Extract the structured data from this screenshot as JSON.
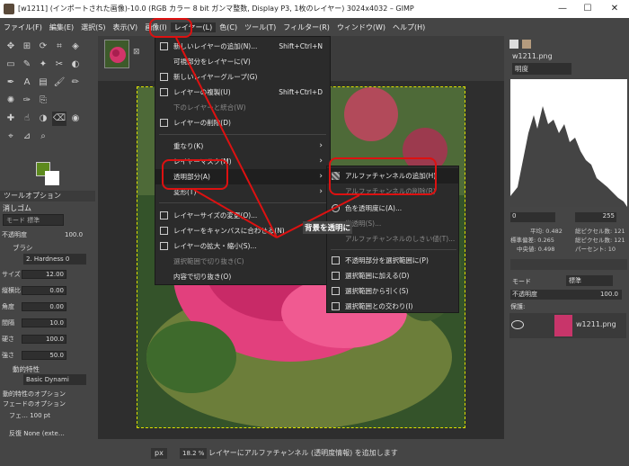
{
  "window": {
    "title": "[w1211] (インポートされた画像)-10.0 (RGB カラー 8 bit ガンマ整数, Display P3, 1枚のレイヤー) 3024x4032 – GIMP",
    "btn_min": "—",
    "btn_max": "☐",
    "btn_close": "✕"
  },
  "menubar": [
    "ファイル(F)",
    "編集(E)",
    "選択(S)",
    "表示(V)",
    "画像(I)",
    "レイヤー(L)",
    "色(C)",
    "ツール(T)",
    "フィルター(R)",
    "ウィンドウ(W)",
    "ヘルプ(H)"
  ],
  "tool_options": {
    "tab": "ツールオプション",
    "mode_label": "消しゴム",
    "mode": "モード  標準",
    "opacity_label": "不透明度",
    "opacity": "100.0",
    "brush_label": "ブラシ",
    "brush": "2. Hardness 0",
    "size_label": "サイズ",
    "size": "12.00",
    "aspect_label": "縦横比",
    "aspect": "0.00",
    "angle_label": "角度",
    "angle": "0.00",
    "spacing_label": "間隔",
    "spacing": "10.0",
    "hardness_label": "硬さ",
    "hardness": "100.0",
    "force_label": "強さ",
    "force": "50.0",
    "dynamics_label": "動的特性",
    "dynamics": "Basic Dynami",
    "dyn_opt": "動的特性のオプション",
    "fade": "フェードのオプション",
    "fade_val": "フェ… 100 pt",
    "repeat": "反復  None (exte…"
  },
  "layer_menu": {
    "items": [
      {
        "label": "新しいレイヤーの追加(N)...",
        "key": "Shift+Ctrl+N"
      },
      {
        "label": "可視部分をレイヤーに(V)",
        "key": ""
      },
      {
        "label": "新しいレイヤーグループ(G)",
        "key": ""
      },
      {
        "label": "レイヤーの複製(U)",
        "key": "Shift+Ctrl+D"
      },
      {
        "label": "下のレイヤーと統合(W)",
        "key": ""
      },
      {
        "label": "レイヤーの削除(D)",
        "key": ""
      },
      {
        "label": "重なり(K)",
        "key": ""
      },
      {
        "label": "レイヤーマスク(M)",
        "key": ""
      },
      {
        "label": "透明部分(A)",
        "key": ""
      },
      {
        "label": "変形(T)",
        "key": ""
      },
      {
        "label": "レイヤーサイズの変更(O)...",
        "key": ""
      },
      {
        "label": "レイヤーをキャンバスに合わせる(N)",
        "key": ""
      },
      {
        "label": "レイヤーの拡大・縮小(S)...",
        "key": ""
      },
      {
        "label": "選択範囲で切り抜き(C)",
        "key": ""
      },
      {
        "label": "内容で切り抜き(O)",
        "key": ""
      }
    ]
  },
  "transparency_submenu": {
    "items": [
      {
        "label": "アルファチャンネルの追加(H)"
      },
      {
        "label": "アルファチャンネルの削除(R)"
      },
      {
        "label": "色を透明度に(A)..."
      },
      {
        "label": "半透明(S)..."
      },
      {
        "label": "アルファチャンネルのしきい値(T)..."
      },
      {
        "label": "不透明部分を選択範囲に(P)"
      },
      {
        "label": "選択範囲に加える(D)"
      },
      {
        "label": "選択範囲から引く(S)"
      },
      {
        "label": "選択範囲との交わり(I)"
      }
    ]
  },
  "annotation": "背景を透明に",
  "status": {
    "unit": "px",
    "zoom": "18.2 %",
    "message": "レイヤーにアルファチャンネル (透明度情報) を追加します"
  },
  "right_dock": {
    "image_name": "w1211.png",
    "channel": "明度",
    "range_min": "0",
    "range_max": "255",
    "stats": [
      "平均: 0.482",
      "標準偏差: 0.265",
      "中央値: 0.498",
      "総ピクセル数: 121",
      "総ピクセル数: 121",
      "パーセント: 10"
    ],
    "layers_mode_label": "モード",
    "layers_mode": "標準",
    "layers_opacity_label": "不透明度",
    "layers_opacity": "100.0",
    "lock_label": "保護:",
    "layer_name": "w1211.png"
  },
  "colors": {
    "highlight_red": "#dd1111",
    "fg": "#5d8a1e",
    "bg": "#ffffff"
  }
}
